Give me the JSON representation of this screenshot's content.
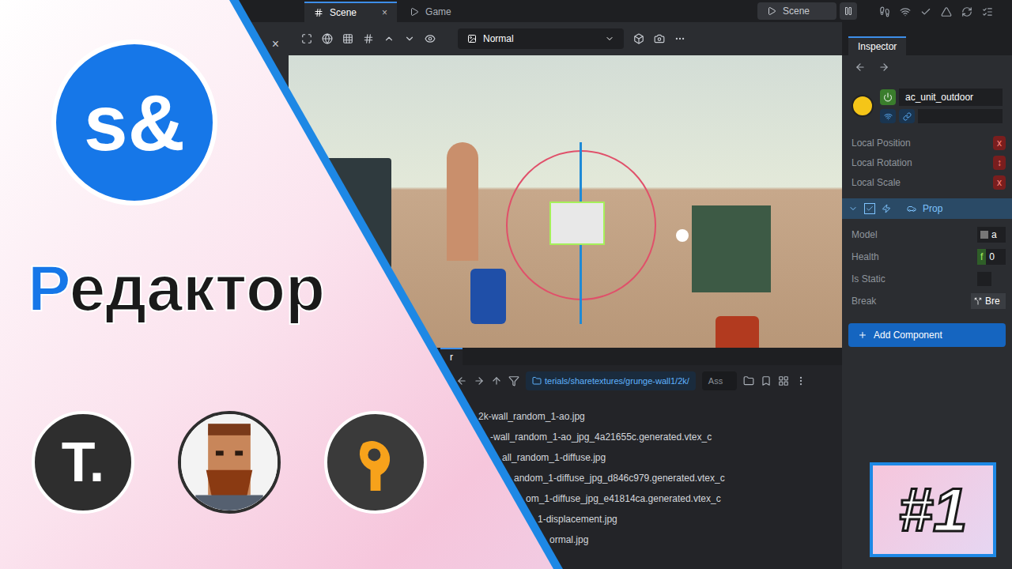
{
  "logo": {
    "text": "s&"
  },
  "title": {
    "accent": "Р",
    "rest": "едактор"
  },
  "channel_icons": [
    {
      "kind": "letter",
      "text": "T."
    },
    {
      "kind": "face"
    },
    {
      "kind": "logo"
    }
  ],
  "episode": "#1",
  "editor": {
    "left_panel": {
      "close": "×"
    },
    "tabs": [
      {
        "label": "Scene",
        "selected": true,
        "close": "×"
      },
      {
        "label": "Game",
        "selected": false
      }
    ],
    "play": {
      "label": "Scene"
    },
    "viewport": {
      "render_mode": "Normal"
    },
    "inspector": {
      "title": "Inspector",
      "name": "ac_unit_outdoor",
      "enabled": true,
      "transform": [
        {
          "label": "Local Position",
          "button": "x"
        },
        {
          "label": "Local Rotation",
          "button": "↕"
        },
        {
          "label": "Local Scale",
          "button": "x"
        }
      ],
      "component": {
        "name": "Prop",
        "enabled": true
      },
      "properties": [
        {
          "label": "Model",
          "kind": "asset",
          "value": "a"
        },
        {
          "label": "Health",
          "kind": "number",
          "prefix": "f",
          "value": "0"
        },
        {
          "label": "Is Static",
          "kind": "checkbox",
          "checked": false
        },
        {
          "label": "Break",
          "kind": "button",
          "value": "Bre"
        }
      ],
      "add_component": "Add Component"
    },
    "assets": {
      "tab": "r",
      "path": "terials/sharetextures/grunge-wall1/2k/",
      "search": "Ass",
      "files": [
        "2k-wall_random_1-ao.jpg",
        "-wall_random_1-ao_jpg_4a21655c.generated.vtex_c",
        "all_random_1-diffuse.jpg",
        "andom_1-diffuse_jpg_d846c979.generated.vtex_c",
        "om_1-diffuse_jpg_e41814ca.generated.vtex_c",
        "1-displacement.jpg",
        "ormal.jpg"
      ]
    }
  }
}
